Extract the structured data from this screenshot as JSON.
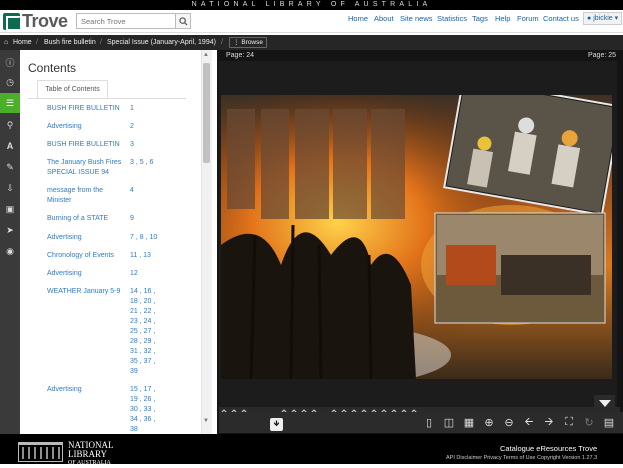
{
  "banner": "NATIONAL LIBRARY OF AUSTRALIA",
  "logo": {
    "word": "Trove"
  },
  "search": {
    "placeholder": "Search Trove"
  },
  "topnav": [
    "Home",
    "About",
    "Site news",
    "Statistics",
    "Tags",
    "Help",
    "Forum",
    "Contact us"
  ],
  "user": {
    "label": "jbickie"
  },
  "breadcrumb": {
    "home": "Home",
    "item1": "Bush fire bulletin",
    "item2": "Special Issue (January-April, 1994)",
    "browse": "Browse"
  },
  "rail": [
    "info-icon",
    "clock-icon",
    "list-icon",
    "search-icon",
    "text-icon",
    "tag-icon",
    "download-icon",
    "cart-icon",
    "share-icon",
    "eye-icon"
  ],
  "contents": {
    "title": "Contents",
    "tab": "Table of Contents",
    "items": [
      {
        "title": "BUSH FIRE BULLETIN",
        "pages": "1"
      },
      {
        "title": "Advertising",
        "pages": "2"
      },
      {
        "title": "BUSH FIRE BULLETIN",
        "pages": "3"
      },
      {
        "title": "The January Bush Fires SPECIAL ISSUE 94",
        "pages": "3 , 5 , 6"
      },
      {
        "title": "message from the Minister",
        "pages": "4"
      },
      {
        "title": "Burning of a STATE",
        "pages": "9"
      },
      {
        "title": "Advertising",
        "pages": "7 , 8 , 10"
      },
      {
        "title": "Chronology of Events",
        "pages": "11 , 13"
      },
      {
        "title": "Advertising",
        "pages": "12"
      },
      {
        "title": "WEATHER January 5-9",
        "pages": "14 , 16 , 18 , 20 , 21 , 22 , 23 , 24 , 25 , 27 , 28 , 29 , 31 , 32 , 35 , 37 , 39"
      },
      {
        "title": "Advertising",
        "pages": "15 , 17 , 19 , 26 , 30 , 33 , 34 , 36 , 38"
      }
    ]
  },
  "viewer": {
    "page_left": "Page: 24",
    "page_right": "Page: 25"
  },
  "footer": {
    "nla_line1": "NATIONAL",
    "nla_line2": "LIBRARY",
    "nla_line3": "OF AUSTRALIA",
    "links": "Catalogue   eResources   Trove",
    "small": "API   Disclaimer   Privacy   Terms of Use   Copyright   Version 1.27.3"
  },
  "colors": {
    "accent": "#4caf2a",
    "link": "#2f7bc4",
    "dark": "#262626"
  }
}
